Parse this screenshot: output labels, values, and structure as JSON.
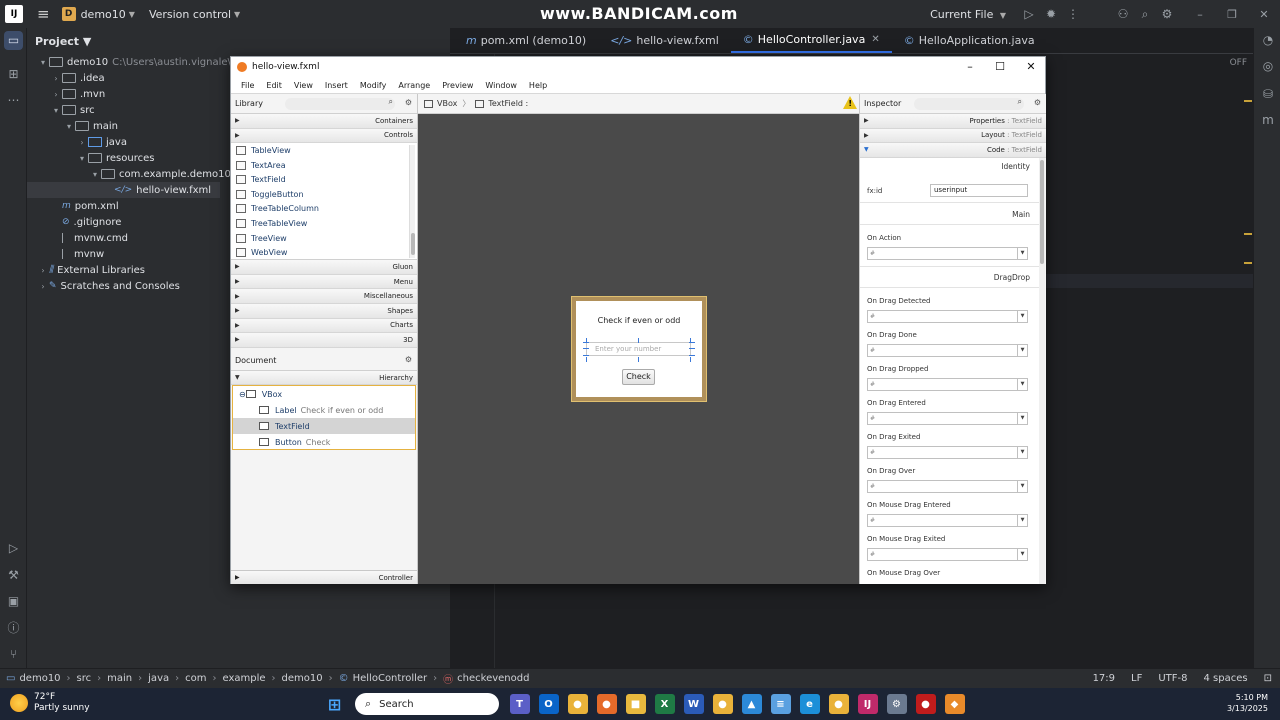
{
  "ide": {
    "watermark": "www.BANDICAM.com",
    "project_badge": "D",
    "project_name": "demo10",
    "version_control": "Version control",
    "run_config": "Current File",
    "panel_title": "Project",
    "tree": [
      {
        "label": "demo10",
        "extra": "C:\\Users\\austin.vignale\\IdeaPr",
        "indent": 0,
        "arrow": "▾",
        "icon": "mod"
      },
      {
        "label": ".idea",
        "indent": 1,
        "arrow": "›",
        "icon": "folder"
      },
      {
        "label": ".mvn",
        "indent": 1,
        "arrow": "›",
        "icon": "folder"
      },
      {
        "label": "src",
        "indent": 1,
        "arrow": "▾",
        "icon": "folder"
      },
      {
        "label": "main",
        "indent": 2,
        "arrow": "▾",
        "icon": "folder"
      },
      {
        "label": "java",
        "indent": 3,
        "arrow": "›",
        "icon": "bluef"
      },
      {
        "label": "resources",
        "indent": 3,
        "arrow": "▾",
        "icon": "folder"
      },
      {
        "label": "com.example.demo10",
        "indent": 4,
        "arrow": "▾",
        "icon": "folder"
      },
      {
        "label": "hello-view.fxml",
        "indent": 5,
        "arrow": "",
        "icon": "code",
        "selected": true
      },
      {
        "label": "pom.xml",
        "indent": 1,
        "arrow": "",
        "icon": "m"
      },
      {
        "label": ".gitignore",
        "indent": 1,
        "arrow": "",
        "icon": "ban"
      },
      {
        "label": "mvnw.cmd",
        "indent": 1,
        "arrow": "",
        "icon": "txt"
      },
      {
        "label": "mvnw",
        "indent": 1,
        "arrow": "",
        "icon": "txt"
      },
      {
        "label": "External Libraries",
        "indent": 0,
        "arrow": "›",
        "icon": "lib"
      },
      {
        "label": "Scratches and Consoles",
        "indent": 0,
        "arrow": "›",
        "icon": "scratch"
      }
    ],
    "tabs": [
      {
        "label": "pom.xml (demo10)",
        "icon": "m",
        "active": false
      },
      {
        "label": "hello-view.fxml",
        "icon": "</>",
        "active": false
      },
      {
        "label": "HelloController.java",
        "icon": "©",
        "active": true,
        "closable": true
      },
      {
        "label": "HelloApplication.java",
        "icon": "©",
        "active": false
      }
    ],
    "editor_badge": "OFF",
    "status": {
      "crumbs": [
        "demo10",
        "src",
        "main",
        "java",
        "com",
        "example",
        "demo10",
        "HelloController",
        "checkevenodd"
      ],
      "position": "17:9",
      "line_sep": "LF",
      "encoding": "UTF-8",
      "indent": "4 spaces"
    }
  },
  "scene_builder": {
    "title": "hello-view.fxml",
    "menu": [
      "File",
      "Edit",
      "View",
      "Insert",
      "Modify",
      "Arrange",
      "Preview",
      "Window",
      "Help"
    ],
    "library": {
      "title": "Library",
      "categories_top": [
        "Containers",
        "Controls"
      ],
      "items": [
        "TableView",
        "TextArea",
        "TextField",
        "ToggleButton",
        "TreeTableColumn",
        "TreeTableView",
        "TreeView",
        "WebView"
      ],
      "categories_bottom": [
        "Gluon",
        "Menu",
        "Miscellaneous",
        "Shapes",
        "Charts",
        "3D"
      ]
    },
    "document": {
      "title": "Document",
      "section": "Hierarchy",
      "nodes": [
        {
          "type": "VBox",
          "value": "",
          "level": 0
        },
        {
          "type": "Label",
          "value": "Check if even or odd",
          "level": 1
        },
        {
          "type": "TextField",
          "value": "",
          "level": 1,
          "selected": true
        },
        {
          "type": "Button",
          "value": "Check",
          "level": 1
        }
      ],
      "controller": "Controller"
    },
    "breadcrumb": [
      "VBox",
      "TextField :"
    ],
    "preview": {
      "label": "Check if even or odd",
      "placeholder": "Enter your number",
      "button": "Check"
    },
    "inspector": {
      "title": "Inspector",
      "sections": [
        {
          "name": "Properties",
          "sub": "TextField",
          "open": false
        },
        {
          "name": "Layout",
          "sub": "TextField",
          "open": false
        },
        {
          "name": "Code",
          "sub": "TextField",
          "open": true
        }
      ],
      "identity": "Identity",
      "fxid_label": "fx:id",
      "fxid_value": "userinput",
      "main": "Main",
      "on_action": "On Action",
      "dragdrop": "DragDrop",
      "handlers": [
        "On Drag Detected",
        "On Drag Done",
        "On Drag Dropped",
        "On Drag Entered",
        "On Drag Exited",
        "On Drag Over",
        "On Mouse Drag Entered",
        "On Mouse Drag Exited",
        "On Mouse Drag Over"
      ],
      "hash": "#"
    }
  },
  "taskbar": {
    "temp": "72°F",
    "weather": "Partly sunny",
    "search": "Search",
    "time": "5:10 PM",
    "date": "3/13/2025",
    "apps": [
      {
        "name": "teams",
        "color": "#5b5fc7",
        "glyph": "T"
      },
      {
        "name": "outlook",
        "color": "#0a64c8",
        "glyph": "O"
      },
      {
        "name": "chrome",
        "color": "#e9b23a",
        "glyph": "●"
      },
      {
        "name": "firefox",
        "color": "#e56a2a",
        "glyph": "●"
      },
      {
        "name": "explorer",
        "color": "#e8b83e",
        "glyph": "■"
      },
      {
        "name": "excel",
        "color": "#1f7a45",
        "glyph": "X"
      },
      {
        "name": "word",
        "color": "#2b5bb8",
        "glyph": "W"
      },
      {
        "name": "chrome2",
        "color": "#e9b23a",
        "glyph": "●"
      },
      {
        "name": "photos",
        "color": "#2c89d8",
        "glyph": "▲"
      },
      {
        "name": "notepad",
        "color": "#5aa0e0",
        "glyph": "≡"
      },
      {
        "name": "edge",
        "color": "#1c8fd8",
        "glyph": "e"
      },
      {
        "name": "chrome3",
        "color": "#e9b23a",
        "glyph": "●"
      },
      {
        "name": "intellij",
        "color": "#c02a6a",
        "glyph": "IJ"
      },
      {
        "name": "settings",
        "color": "#6b7a90",
        "glyph": "⚙"
      },
      {
        "name": "bandicam",
        "color": "#c01c1c",
        "glyph": "●"
      },
      {
        "name": "scenebuilder",
        "color": "#e88a2a",
        "glyph": "◆"
      }
    ]
  }
}
